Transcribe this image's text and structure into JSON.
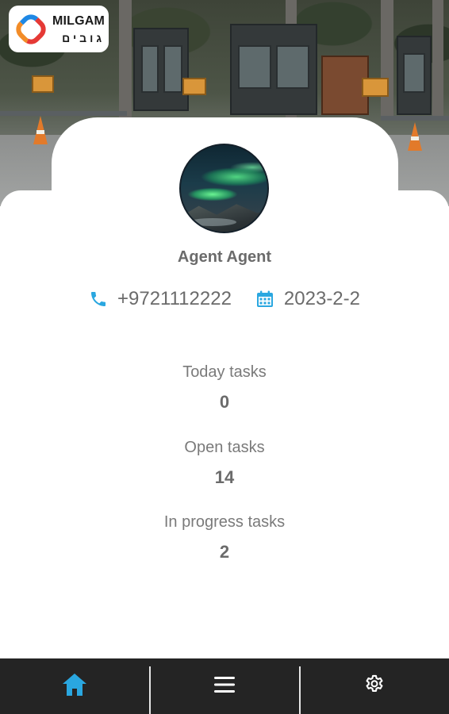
{
  "logo": {
    "text_en": "MILGAM",
    "text_he": "גובים",
    "colors": [
      "#e53935",
      "#f28c28",
      "#1e88e5",
      "#26c6da"
    ]
  },
  "profile": {
    "name": "Agent Agent",
    "phone": "+9721112222",
    "date": "2023-2-2",
    "icons": {
      "phone": "phone-icon",
      "date": "calendar-icon"
    }
  },
  "stats": [
    {
      "label": "Today tasks",
      "value": "0"
    },
    {
      "label": "Open tasks",
      "value": "14"
    },
    {
      "label": "In progress tasks",
      "value": "2"
    }
  ],
  "nav": {
    "items": [
      {
        "icon": "home-icon",
        "active": true,
        "color": "#2aa7e0"
      },
      {
        "icon": "menu-icon",
        "active": false,
        "color": "#ffffff"
      },
      {
        "icon": "gear-icon",
        "active": false,
        "color": "#ffffff"
      }
    ]
  },
  "colors": {
    "accent": "#2aa7e0",
    "text_primary": "#6b6b6b",
    "nav_background": "#242424"
  }
}
